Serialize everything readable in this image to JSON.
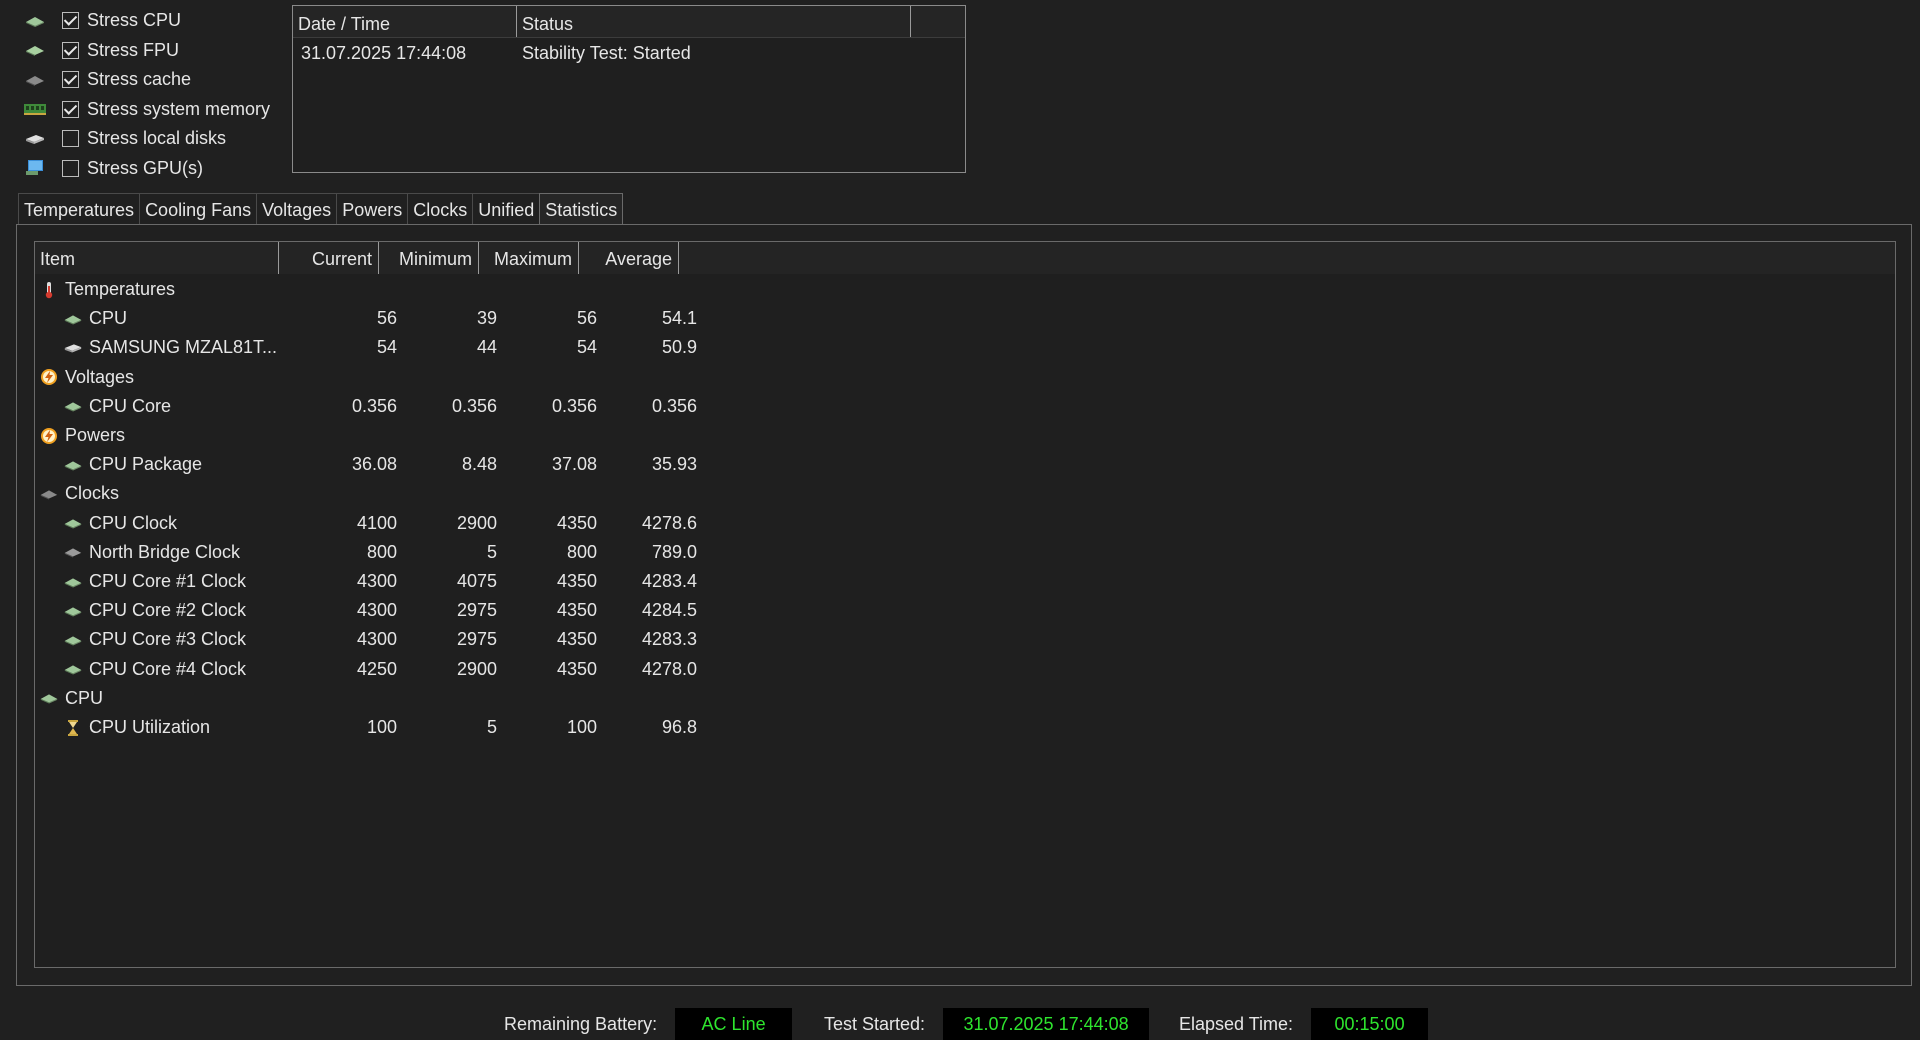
{
  "stress_options": [
    {
      "label": "Stress CPU",
      "checked": true,
      "icon": "cpu-chip-icon"
    },
    {
      "label": "Stress FPU",
      "checked": true,
      "icon": "fpu-chip-icon"
    },
    {
      "label": "Stress cache",
      "checked": true,
      "icon": "cache-chip-icon"
    },
    {
      "label": "Stress system memory",
      "checked": true,
      "icon": "memory-module-icon"
    },
    {
      "label": "Stress local disks",
      "checked": false,
      "icon": "disk-drive-icon"
    },
    {
      "label": "Stress GPU(s)",
      "checked": false,
      "icon": "gpu-monitor-icon"
    }
  ],
  "log": {
    "columns": [
      "Date / Time",
      "Status"
    ],
    "rows": [
      {
        "datetime": "31.07.2025 17:44:08",
        "status": "Stability Test: Started"
      }
    ]
  },
  "tabs": [
    "Temperatures",
    "Cooling Fans",
    "Voltages",
    "Powers",
    "Clocks",
    "Unified",
    "Statistics"
  ],
  "active_tab": "Statistics",
  "stats": {
    "columns": [
      "Item",
      "Current",
      "Minimum",
      "Maximum",
      "Average"
    ],
    "rows": [
      {
        "type": "group",
        "label": "Temperatures",
        "icon": "thermometer-icon"
      },
      {
        "type": "item",
        "label": "CPU",
        "icon": "cpu-chip-icon",
        "current": "56",
        "minimum": "39",
        "maximum": "56",
        "average": "54.1"
      },
      {
        "type": "item",
        "label": "SAMSUNG MZAL81T...",
        "icon": "disk-drive-icon",
        "current": "54",
        "minimum": "44",
        "maximum": "54",
        "average": "50.9"
      },
      {
        "type": "group",
        "label": "Voltages",
        "icon": "lightning-icon"
      },
      {
        "type": "item",
        "label": "CPU Core",
        "icon": "cpu-chip-icon",
        "current": "0.356",
        "minimum": "0.356",
        "maximum": "0.356",
        "average": "0.356"
      },
      {
        "type": "group",
        "label": "Powers",
        "icon": "lightning-icon"
      },
      {
        "type": "item",
        "label": "CPU Package",
        "icon": "cpu-chip-icon",
        "current": "36.08",
        "minimum": "8.48",
        "maximum": "37.08",
        "average": "35.93"
      },
      {
        "type": "group",
        "label": "Clocks",
        "icon": "chip-icon"
      },
      {
        "type": "item",
        "label": "CPU Clock",
        "icon": "cpu-chip-icon",
        "current": "4100",
        "minimum": "2900",
        "maximum": "4350",
        "average": "4278.6"
      },
      {
        "type": "item",
        "label": "North Bridge Clock",
        "icon": "chipset-icon",
        "current": "800",
        "minimum": "5",
        "maximum": "800",
        "average": "789.0"
      },
      {
        "type": "item",
        "label": "CPU Core #1 Clock",
        "icon": "cpu-chip-icon",
        "current": "4300",
        "minimum": "4075",
        "maximum": "4350",
        "average": "4283.4"
      },
      {
        "type": "item",
        "label": "CPU Core #2 Clock",
        "icon": "cpu-chip-icon",
        "current": "4300",
        "minimum": "2975",
        "maximum": "4350",
        "average": "4284.5"
      },
      {
        "type": "item",
        "label": "CPU Core #3 Clock",
        "icon": "cpu-chip-icon",
        "current": "4300",
        "minimum": "2975",
        "maximum": "4350",
        "average": "4283.3"
      },
      {
        "type": "item",
        "label": "CPU Core #4 Clock",
        "icon": "cpu-chip-icon",
        "current": "4250",
        "minimum": "2900",
        "maximum": "4350",
        "average": "4278.0"
      },
      {
        "type": "group",
        "label": "CPU",
        "icon": "cpu-chip-icon"
      },
      {
        "type": "item",
        "label": "CPU Utilization",
        "icon": "hourglass-icon",
        "current": "100",
        "minimum": "5",
        "maximum": "100",
        "average": "96.8"
      }
    ]
  },
  "status_bar": {
    "battery_label": "Remaining Battery:",
    "battery_value": "AC Line",
    "started_label": "Test Started:",
    "started_value": "31.07.2025 17:44:08",
    "elapsed_label": "Elapsed Time:",
    "elapsed_value": "00:15:00"
  },
  "colors": {
    "background": "#202020",
    "text": "#e6e6e6",
    "status_value_text": "#2ee52e",
    "status_value_bg": "#000000"
  }
}
